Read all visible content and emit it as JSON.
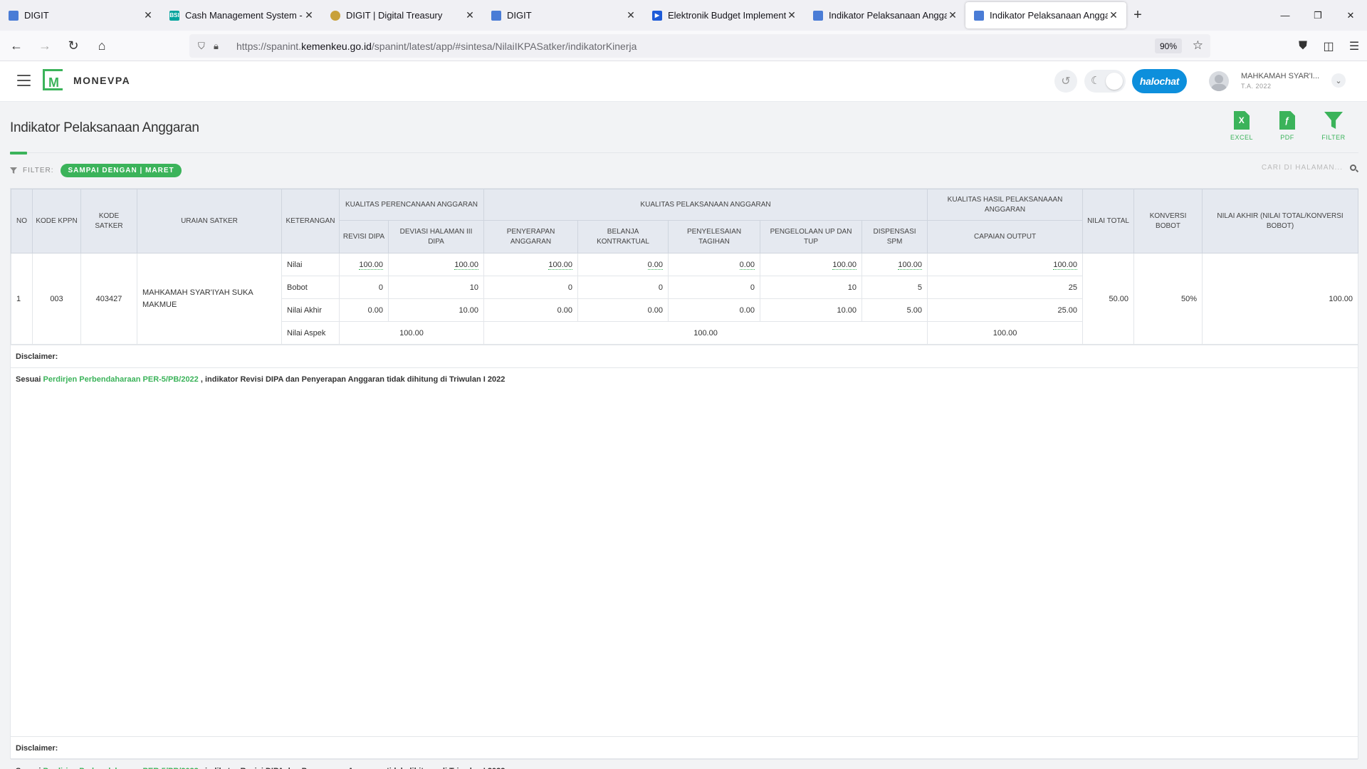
{
  "browser": {
    "tabs": [
      {
        "title": "DIGIT",
        "icon": "doc-icon",
        "color": "#4a7cd6",
        "active": false
      },
      {
        "title": "Cash Management System - Ba",
        "icon": "bsi-icon",
        "color": "#00a39d",
        "active": false
      },
      {
        "title": "DIGIT | Digital Treasury",
        "icon": "treasury-emblem-icon",
        "color": "#c8a13a",
        "active": false
      },
      {
        "title": "DIGIT",
        "icon": "doc-icon",
        "color": "#4a7cd6",
        "active": false
      },
      {
        "title": "Elektronik Budget Implementati",
        "icon": "budget-icon",
        "color": "#1e5bd8",
        "active": false
      },
      {
        "title": "Indikator Pelaksanaan Anggaran",
        "icon": "doc-icon",
        "color": "#4a7cd6",
        "active": false
      },
      {
        "title": "Indikator Pelaksanaan Anggaran",
        "icon": "doc-icon",
        "color": "#4a7cd6",
        "active": true
      }
    ],
    "url_prefix": "https://spanint.",
    "url_domain": "kemenkeu.go.id",
    "url_path": "/spanint/latest/app/#sintesa/NilaiIKPASatker/indikatorKinerja",
    "zoom": "90%"
  },
  "app": {
    "brand": "MONEVPA",
    "logo_letter": "M",
    "chat_label": "halochat",
    "user_name": "MAHKAMAH SYAR'I...",
    "user_year": "T.A. 2022",
    "accent": "#3bb35a"
  },
  "page": {
    "title": "Indikator Pelaksanaan Anggaran",
    "actions": {
      "excel": "EXCEL",
      "pdf": "PDF",
      "filter": "FILTER"
    },
    "filter_label": "FILTER:",
    "filter_chip": "SAMPAI DENGAN | MARET",
    "search_placeholder": "CARI DI HALAMAN..."
  },
  "table": {
    "headers": {
      "no": "NO",
      "kode_kppn": "KODE KPPN",
      "kode_satker": "KODE SATKER",
      "uraian": "URAIAN SATKER",
      "keterangan": "KETERANGAN",
      "grp_perencanaan": "KUALITAS PERENCANAAN ANGGARAN",
      "grp_pelaksanaan": "KUALITAS PELAKSANAAN ANGGARAN",
      "grp_hasil": "KUALITAS HASIL PELAKSANAAAN ANGGARAN",
      "nilai_total": "NILAI TOTAL",
      "konversi": "KONVERSI BOBOT",
      "nilai_akhir": "NILAI AKHIR (NILAI TOTAL/KONVERSI BOBOT)",
      "revisi": "REVISI DIPA",
      "deviasi": "DEVIASI HALAMAN III DIPA",
      "penyerapan": "PENYERAPAN ANGGARAN",
      "belanja": "BELANJA KONTRAKTUAL",
      "penyelesaian": "PENYELESAIAN TAGIHAN",
      "pengelolaan": "PENGELOLAAN UP DAN TUP",
      "dispensasi": "DISPENSASI SPM",
      "capaian": "CAPAIAN OUTPUT"
    },
    "row": {
      "no": "1",
      "kode_kppn": "003",
      "kode_satker": "403427",
      "uraian": "MAHKAMAH SYAR'IYAH SUKA MAKMUE",
      "nilai_total": "50.00",
      "konversi": "50%",
      "nilai_akhir": "100.00",
      "lines": [
        {
          "label": "Nilai",
          "vals": [
            "100.00",
            "100.00",
            "100.00",
            "0.00",
            "0.00",
            "100.00",
            "100.00",
            "100.00"
          ]
        },
        {
          "label": "Bobot",
          "vals": [
            "0",
            "10",
            "0",
            "0",
            "0",
            "10",
            "5",
            "25"
          ]
        },
        {
          "label": "Nilai Akhir",
          "vals": [
            "0.00",
            "10.00",
            "0.00",
            "0.00",
            "0.00",
            "10.00",
            "5.00",
            "25.00"
          ]
        }
      ],
      "aspek_label": "Nilai Aspek",
      "aspek": [
        "100.00",
        "100.00",
        "100.00"
      ]
    }
  },
  "disclaimer": {
    "label": "Disclaimer:",
    "prefix": "Sesuai",
    "link": "Perdirjen Perbendaharaan PER-5/PB/2022",
    "suffix": ", indikator Revisi DIPA dan Penyerapan Anggaran tidak dihitung di Triwulan I 2022"
  }
}
